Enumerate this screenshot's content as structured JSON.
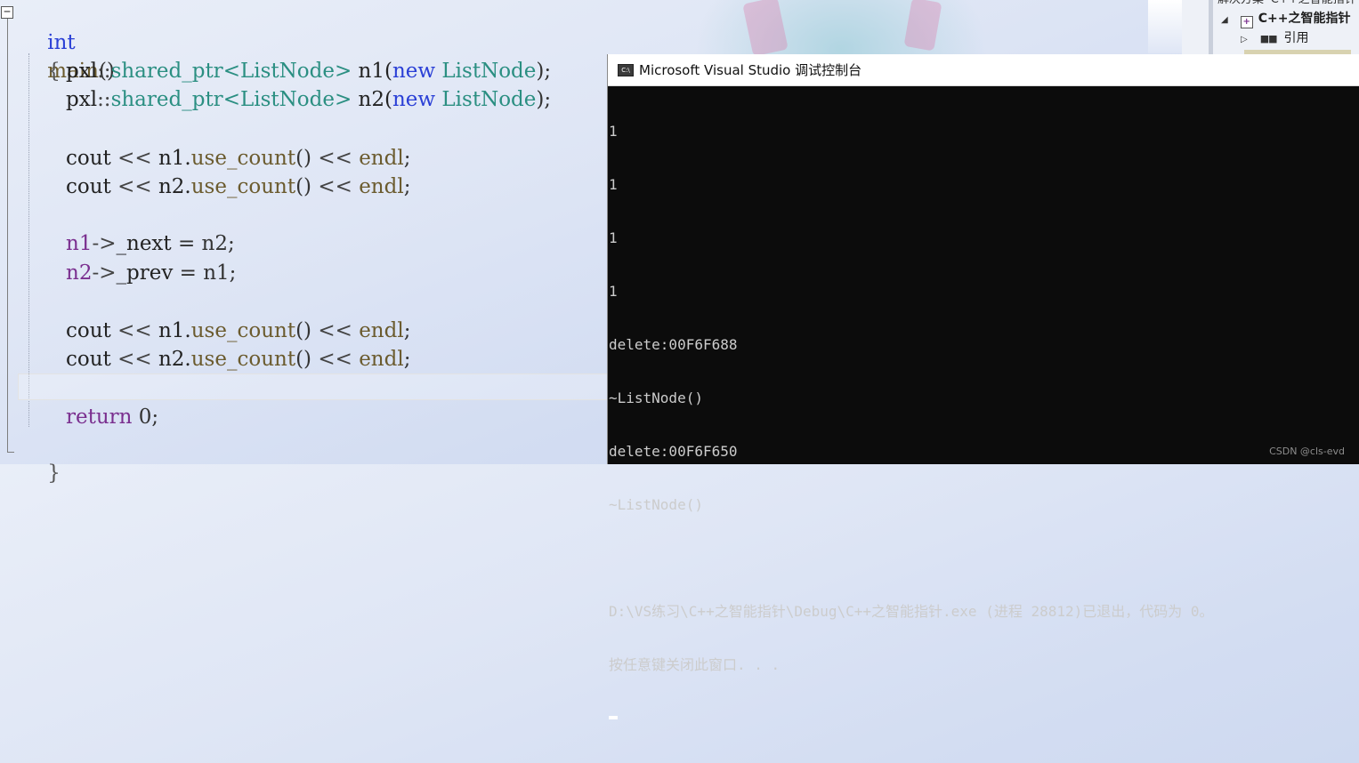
{
  "editor": {
    "collapse_symbol": "−",
    "lines": {
      "l1": {
        "kw": "int",
        "fn": "main",
        "rest": "()"
      },
      "l2": {
        "brace": "{"
      },
      "l3": {
        "ns": "pxl",
        "sep": "::",
        "tmpl": "shared_ptr",
        "lt": "<",
        "type": "ListNode",
        "gt": ">",
        "var": " n1(",
        "kw": "new",
        "type2": " ListNode",
        "end": ");"
      },
      "l4": {
        "ns": "pxl",
        "sep": "::",
        "tmpl": "shared_ptr",
        "lt": "<",
        "type": "ListNode",
        "gt": ">",
        "var": " n2(",
        "kw": "new",
        "type2": " ListNode",
        "end": ");"
      },
      "l5": {
        "a": "cout",
        "op1": " << ",
        "obj": "n1.",
        "call": "use_count",
        "paren": "()",
        "op2": " << ",
        "endl": "endl",
        "semi": ";"
      },
      "l6": {
        "a": "cout",
        "op1": " << ",
        "obj": "n2.",
        "call": "use_count",
        "paren": "()",
        "op2": " << ",
        "endl": "endl",
        "semi": ";"
      },
      "l7": {
        "obj": "n1",
        "arrow": "->",
        "mem": "_next",
        "rest": " = n2;"
      },
      "l8": {
        "obj": "n2",
        "arrow": "->",
        "mem": "_prev",
        "rest": " = n1;"
      },
      "l9": {
        "a": "cout",
        "op1": " << ",
        "obj": "n1.",
        "call": "use_count",
        "paren": "()",
        "op2": " << ",
        "endl": "endl",
        "semi": ";"
      },
      "l10": {
        "a": "cout",
        "op1": " << ",
        "obj": "n2.",
        "call": "use_count",
        "paren": "()",
        "op2": " << ",
        "endl": "endl",
        "semi": ";"
      },
      "l11": {
        "kw": "return",
        "rest": " 0;"
      },
      "l12": {
        "brace": "}"
      }
    }
  },
  "solution_explorer": {
    "partial_row": "解决方案 'C++之智能指针'",
    "project_label": "C++之智能指针",
    "project_icon": "project-icon",
    "references_label": "引用"
  },
  "console": {
    "app_icon_text": "C:\\",
    "title": "Microsoft Visual Studio 调试控制台",
    "output_lines": [
      "1",
      "1",
      "1",
      "1",
      "delete:00F6F688",
      "~ListNode()",
      "delete:00F6F650",
      "~ListNode()",
      "",
      "D:\\VS练习\\C++之智能指针\\Debug\\C++之智能指针.exe (进程 28812)已退出，代码为 0。",
      "按任意键关闭此窗口. . ."
    ]
  },
  "watermark": "CSDN @cls-evd",
  "colors": {
    "keyword": "#2a3fd6",
    "type": "#2b8f82",
    "function": "#6b5b2e",
    "console_bg": "#0c0c0c",
    "console_text": "#cccccc"
  }
}
